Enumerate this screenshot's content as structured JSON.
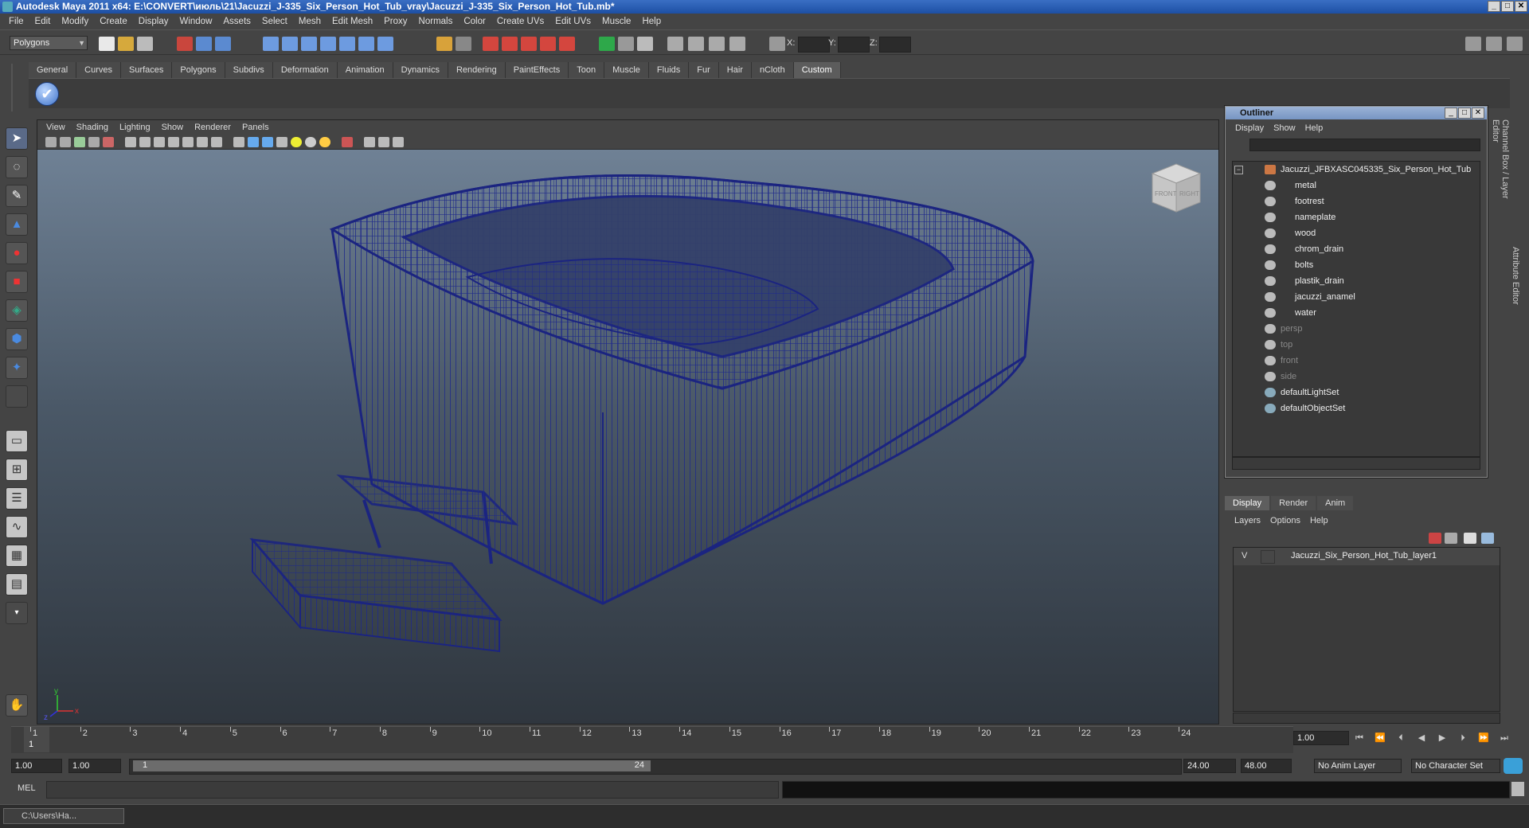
{
  "window": {
    "title": "Autodesk Maya 2011 x64: E:\\CONVERT\\июль\\21\\Jacuzzi_J-335_Six_Person_Hot_Tub_vray\\Jacuzzi_J-335_Six_Person_Hot_Tub.mb*",
    "min": "_",
    "max": "□",
    "close": "✕"
  },
  "menubar": [
    "File",
    "Edit",
    "Modify",
    "Create",
    "Display",
    "Window",
    "Assets",
    "Select",
    "Mesh",
    "Edit Mesh",
    "Proxy",
    "Normals",
    "Color",
    "Create UVs",
    "Edit UVs",
    "Muscle",
    "Help"
  ],
  "status": {
    "mode": "Polygons",
    "coord_x": "X:",
    "coord_y": "Y:",
    "coord_z": "Z:"
  },
  "shelf": {
    "tabs": [
      "General",
      "Curves",
      "Surfaces",
      "Polygons",
      "Subdivs",
      "Deformation",
      "Animation",
      "Dynamics",
      "Rendering",
      "PaintEffects",
      "Toon",
      "Muscle",
      "Fluids",
      "Fur",
      "Hair",
      "nCloth",
      "Custom"
    ],
    "active": "Custom",
    "check_icon": "✔"
  },
  "viewport": {
    "menu": [
      "View",
      "Shading",
      "Lighting",
      "Show",
      "Renderer",
      "Panels"
    ],
    "camera": "persp",
    "viewcube_front": "FRONT",
    "viewcube_right": "RIGHT",
    "axis_x": "x",
    "axis_y": "y",
    "axis_z": "z"
  },
  "outliner": {
    "title": "Outliner",
    "menu": [
      "Display",
      "Show",
      "Help"
    ],
    "root": "Jacuzzi_JFBXASC045335_Six_Person_Hot_Tub",
    "children": [
      "metal",
      "footrest",
      "nameplate",
      "wood",
      "chrom_drain",
      "bolts",
      "plastik_drain",
      "jacuzzi_anamel",
      "water"
    ],
    "cameras": [
      "persp",
      "top",
      "front",
      "side"
    ],
    "sets": [
      "defaultLightSet",
      "defaultObjectSet"
    ]
  },
  "layers": {
    "tabs": [
      "Display",
      "Render",
      "Anim"
    ],
    "active": "Display",
    "menu": [
      "Layers",
      "Options",
      "Help"
    ],
    "visible_flag": "V",
    "layer_name": "Jacuzzi_Six_Person_Hot_Tub_layer1"
  },
  "timeline": {
    "ticks": [
      "1",
      "2",
      "3",
      "4",
      "5",
      "6",
      "7",
      "8",
      "9",
      "10",
      "11",
      "12",
      "13",
      "14",
      "15",
      "16",
      "17",
      "18",
      "19",
      "20",
      "21",
      "22",
      "23",
      "24"
    ],
    "current_frame": "1.00",
    "current_marker": "1"
  },
  "range": {
    "start": "1.00",
    "playback_start": "1.00",
    "slider_start": "1",
    "slider_end": "24",
    "playback_end": "24.00",
    "end": "48.00",
    "anim_layer": "No Anim Layer",
    "char_set": "No Character Set"
  },
  "command": {
    "label": "MEL"
  },
  "taskbar": {
    "label": "C:\\Users\\Ha..."
  },
  "side_tabs": {
    "channel_box": "Channel Box / Layer Editor",
    "attr_editor": "Attribute Editor"
  }
}
